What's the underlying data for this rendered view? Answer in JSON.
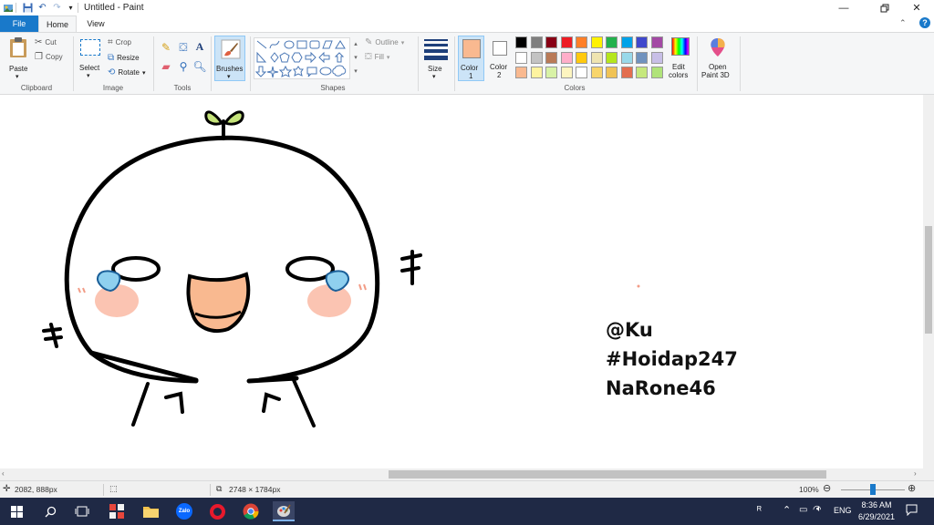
{
  "window": {
    "title": "Untitled - Paint"
  },
  "tabs": [
    {
      "label": "File"
    },
    {
      "label": "Home"
    },
    {
      "label": "View"
    }
  ],
  "ribbon": {
    "clipboard": {
      "group": "Clipboard",
      "paste": "Paste",
      "cut": "Cut",
      "copy": "Copy"
    },
    "image": {
      "group": "Image",
      "select": "Select",
      "crop": "Crop",
      "resize": "Resize",
      "rotate": "Rotate"
    },
    "tools": {
      "group": "Tools"
    },
    "brushes": {
      "label": "Brushes"
    },
    "shapes": {
      "group": "Shapes",
      "outline": "Outline",
      "fill": "Fill"
    },
    "size": {
      "label": "Size"
    },
    "colors": {
      "group": "Colors",
      "color1_label": "Color",
      "color1_num": "1",
      "color2_label": "Color",
      "color2_num": "2",
      "color1_value": "#f9b990",
      "color2_value": "#ffffff",
      "edit_colors": [
        "Edit",
        "colors"
      ],
      "palette_row1": [
        "#000000",
        "#7f7f7f",
        "#880015",
        "#ed1c24",
        "#ff7f27",
        "#fff200",
        "#22b14c",
        "#00a2e8",
        "#3f48cc",
        "#a349a4"
      ],
      "palette_row2": [
        "#ffffff",
        "#c3c3c3",
        "#b97a57",
        "#ffaec9",
        "#ffc90e",
        "#efe4b0",
        "#b5e61d",
        "#99d9ea",
        "#7092be",
        "#c8bfe7"
      ],
      "palette_row3": [
        "#f9b990",
        "#fef3a0",
        "#d8f2a6",
        "#fdf5c0",
        "#ffffff",
        "#f8d56c",
        "#f0c356",
        "#e36e4f",
        "#c6e87d",
        "#b0e37a"
      ]
    },
    "paint3d": [
      "Open",
      "Paint 3D"
    ]
  },
  "canvas": {
    "credits": [
      "@Ku",
      "#Hoidap247",
      "NaRone46"
    ]
  },
  "status": {
    "cursor_pos": "2082, 888px",
    "image_size": "2748 × 1784px",
    "zoom": "100%",
    "zoom_level": 0.5
  },
  "taskbar": {
    "lang": "ENG",
    "time": "8:36 AM",
    "date": "6/29/2021"
  }
}
